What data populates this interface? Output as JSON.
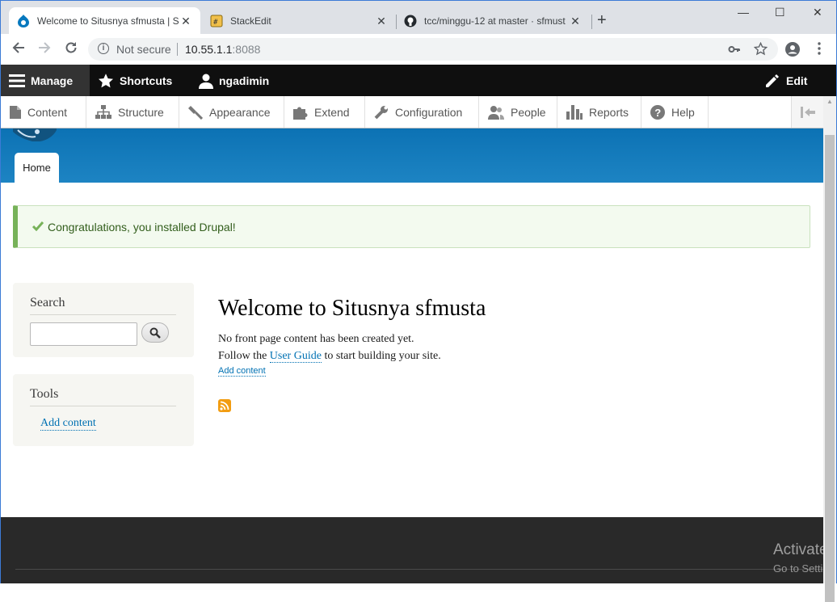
{
  "browser": {
    "tabs": [
      {
        "title": "Welcome to Situsnya sfmusta | Si",
        "close": "✕"
      },
      {
        "title": "StackEdit",
        "close": "✕"
      },
      {
        "title": "tcc/minggu-12 at master · sfmust",
        "close": "✕"
      }
    ],
    "new_tab": "+",
    "window_controls": {
      "minimize": "—",
      "maximize": "☐",
      "close": "✕"
    },
    "not_secure": "Not secure",
    "url_host": "10.55.1.1",
    "url_port": ":8088"
  },
  "toolbar": {
    "manage": "Manage",
    "shortcuts": "Shortcuts",
    "user": "ngadimin",
    "edit": "Edit"
  },
  "tray": {
    "items": [
      {
        "label": "Content"
      },
      {
        "label": "Structure"
      },
      {
        "label": "Appearance"
      },
      {
        "label": "Extend"
      },
      {
        "label": "Configuration"
      },
      {
        "label": "People"
      },
      {
        "label": "Reports"
      },
      {
        "label": "Help"
      }
    ]
  },
  "page": {
    "home_tab": "Home",
    "status_message": "Congratulations, you installed Drupal!",
    "search_block_title": "Search",
    "search_value": "",
    "tools_block_title": "Tools",
    "tools_link": "Add content",
    "title": "Welcome to Situsnya sfmusta",
    "line1": "No front page content has been created yet.",
    "line2_before": "Follow the ",
    "line2_link": "User Guide",
    "line2_after": " to start building your site.",
    "add_content": "Add content"
  },
  "watermark": {
    "line1": "Activate",
    "line2": "Go to Setti"
  },
  "colors": {
    "header_blue": "#0c72b4",
    "link": "#0071b3",
    "status_green": "#77b259",
    "rss_orange": "#f29d12"
  }
}
